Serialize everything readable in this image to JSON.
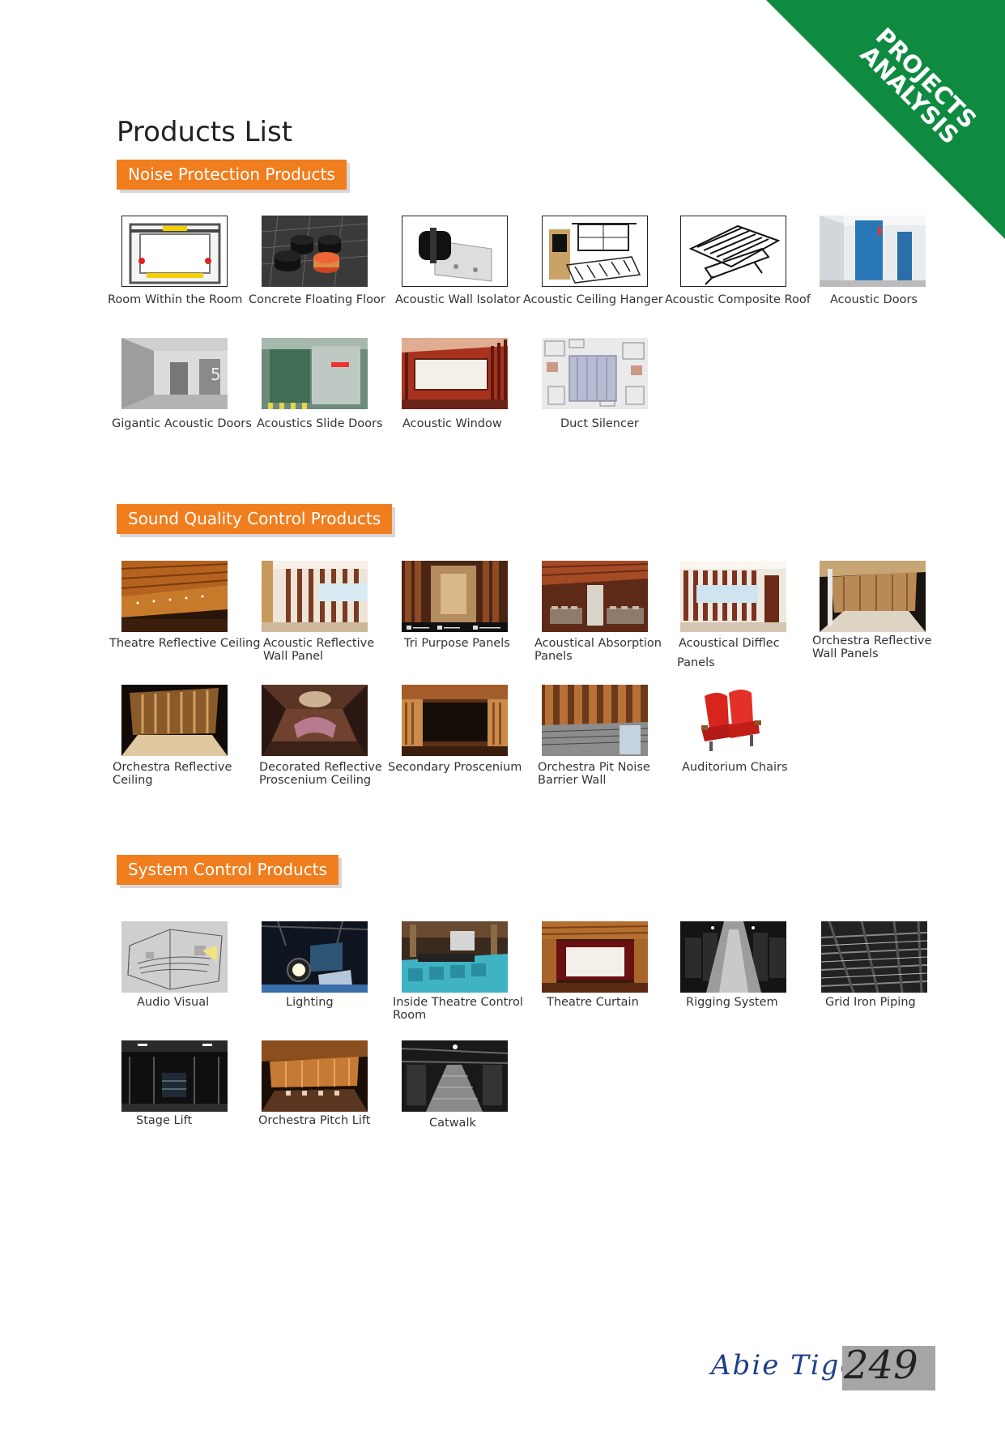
{
  "corner_badge": {
    "line1": "PROJECTS",
    "line2": "ANALYSIS"
  },
  "page_title": "Products List",
  "sections": [
    {
      "title": "Noise Protection Products",
      "items": [
        {
          "label": "Room Within the Room",
          "icon": "room-diagram"
        },
        {
          "label": "Concrete Floating Floor",
          "icon": "floor-pads"
        },
        {
          "label": "Acoustic Wall Isolator",
          "icon": "wall-isolator"
        },
        {
          "label": "Acoustic Ceiling Hanger",
          "icon": "ceiling-hanger"
        },
        {
          "label": "Acoustic Composite Roof",
          "icon": "composite-roof"
        },
        {
          "label": "Acoustic Doors",
          "icon": "blue-door"
        },
        {
          "label": "Gigantic Acoustic Doors",
          "icon": "grey-hall"
        },
        {
          "label": "Acoustics Slide Doors",
          "icon": "slide-door"
        },
        {
          "label": "Acoustic Window",
          "icon": "red-room"
        },
        {
          "label": "Duct Silencer",
          "icon": "duct"
        }
      ]
    },
    {
      "title": "Sound Quality Control Products",
      "items": [
        {
          "label": "Theatre Reflective Ceiling",
          "label2": "",
          "icon": "wood-theatre"
        },
        {
          "label": "Acoustic Reflective",
          "label2": "Wall Panel",
          "icon": "wall-panel"
        },
        {
          "label": "Tri Purpose Panels",
          "label2": "",
          "icon": "tri-panels"
        },
        {
          "label": "Acoustical Absorption",
          "label2": "Panels",
          "icon": "absorption"
        },
        {
          "label": "Acoustical Difflec",
          "label2": "Panels",
          "icon": "difflec"
        },
        {
          "label": "Orchestra Reflective",
          "label2": "Wall Panels",
          "icon": "orch-wall"
        },
        {
          "label": "Orchestra Reflective",
          "label2": "Ceiling",
          "icon": "orch-ceiling"
        },
        {
          "label": "Decorated Reflective",
          "label2": "Proscenium Ceiling",
          "icon": "decorated"
        },
        {
          "label": "Secondary Proscenium",
          "label2": "",
          "icon": "proscenium"
        },
        {
          "label": "Orchestra Pit Noise",
          "label2": "Barrier Wall",
          "icon": "pit-wall"
        },
        {
          "label": "Auditorium Chairs",
          "label2": "",
          "icon": "chairs"
        }
      ]
    },
    {
      "title": "System Control Products",
      "items": [
        {
          "label": "Audio Visual",
          "label2": "",
          "icon": "av-wireframe"
        },
        {
          "label": "Lighting",
          "label2": "",
          "icon": "lighting"
        },
        {
          "label": "Inside Theatre Control",
          "label2": "Room",
          "icon": "control-room"
        },
        {
          "label": "Theatre Curtain",
          "label2": "",
          "icon": "curtain"
        },
        {
          "label": "Rigging System",
          "label2": "",
          "icon": "rigging"
        },
        {
          "label": "Grid Iron Piping",
          "label2": "",
          "icon": "grid-iron"
        },
        {
          "label": "Stage Lift",
          "label2": "",
          "icon": "stage-lift"
        },
        {
          "label": "Orchestra Pitch Lift",
          "label2": "",
          "icon": "pitch-lift"
        },
        {
          "label": "Catwalk",
          "label2": "",
          "icon": "catwalk"
        }
      ]
    }
  ],
  "footer": {
    "brand": "Abie Tiger",
    "page_number": "249"
  },
  "colors": {
    "accent_orange": "#f07d1e",
    "corner_green": "#0f8a41",
    "brand_blue": "#1f3f8c"
  }
}
